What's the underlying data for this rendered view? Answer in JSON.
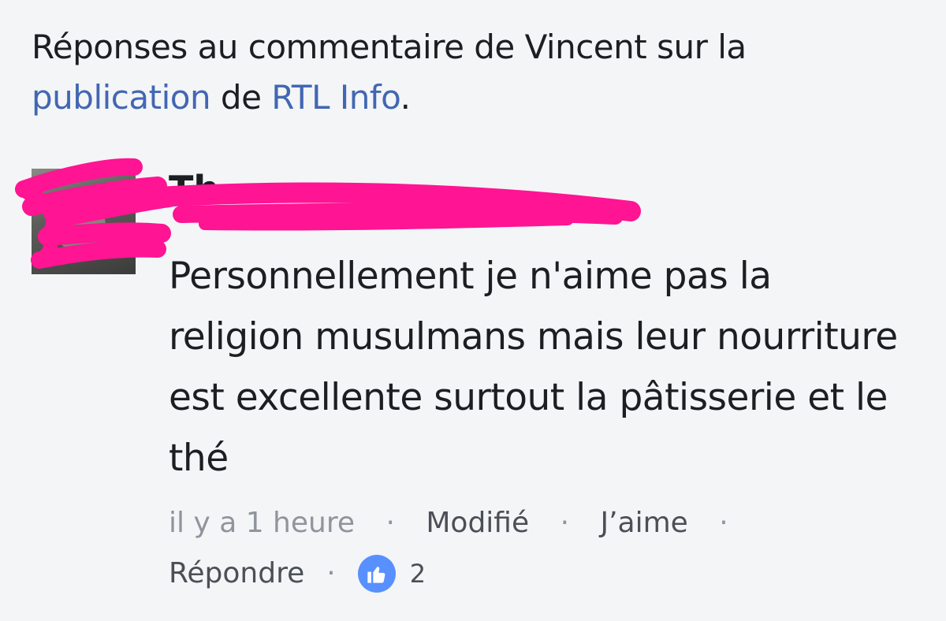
{
  "header": {
    "prefix": "Réponses au commentaire de Vincent sur la",
    "publication_link": "publication",
    "connector": "de",
    "page_link": "RTL Info",
    "suffix": "."
  },
  "comment": {
    "author_visible": "Th",
    "author_redacted": true,
    "text": "Personnellement je n'aime pas la religion musulmans mais leur nourriture est excellente surtout la pâtisserie et le thé",
    "timestamp": "il y a 1 heure",
    "separator": "·",
    "edited_label": "Modifié",
    "like_label": "J’aime",
    "reply_label": "Répondre",
    "like_count": "2",
    "like_icon": "thumbs-up-icon"
  },
  "colors": {
    "link": "#4267b2",
    "like_badge": "#5890ff",
    "redaction": "#ff1493",
    "muted_text": "#90949c"
  }
}
